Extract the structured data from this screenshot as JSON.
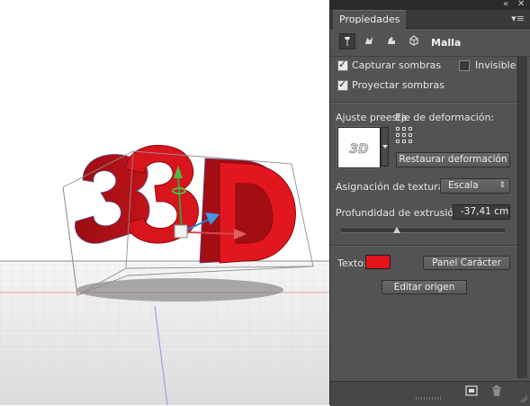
{
  "window": {
    "collapse_icon": "double-chevron-left-icon",
    "close_icon": "close-icon",
    "collapse_glyph": "«",
    "close_glyph": "✕"
  },
  "panel": {
    "tab_label": "Propiedades",
    "menu_glyph": "▾≡",
    "mode_title": "Malla",
    "mode_icons": [
      "mesh-icon",
      "deform-icon",
      "cap-icon",
      "coordinates-icon"
    ]
  },
  "shadows": {
    "capture_label": "Capturar sombras",
    "capture_checked": true,
    "invisible_label": "Invisible",
    "invisible_checked": false,
    "project_label": "Proyectar sombras",
    "project_checked": true
  },
  "deformation": {
    "preset_label": "Ajuste preesta",
    "axis_label": "Eje de deformación:",
    "preview_text": "3D",
    "reset_button": "Restaurar deformación"
  },
  "texture": {
    "label": "Asignación de textura:",
    "value": "Escala",
    "chevron": "⇕"
  },
  "extrusion": {
    "label": "Profundidad de extrusión:",
    "value": "-37,41 cm"
  },
  "text_section": {
    "label": "Texto:",
    "color": "#e4121b",
    "character_button": "Panel Carácter",
    "edit_button": "Editar origen"
  },
  "canvas": {
    "object_text": "3D",
    "object_color": "#d8141c"
  },
  "footer": {
    "icons": [
      "render-icon",
      "trash-icon"
    ]
  }
}
